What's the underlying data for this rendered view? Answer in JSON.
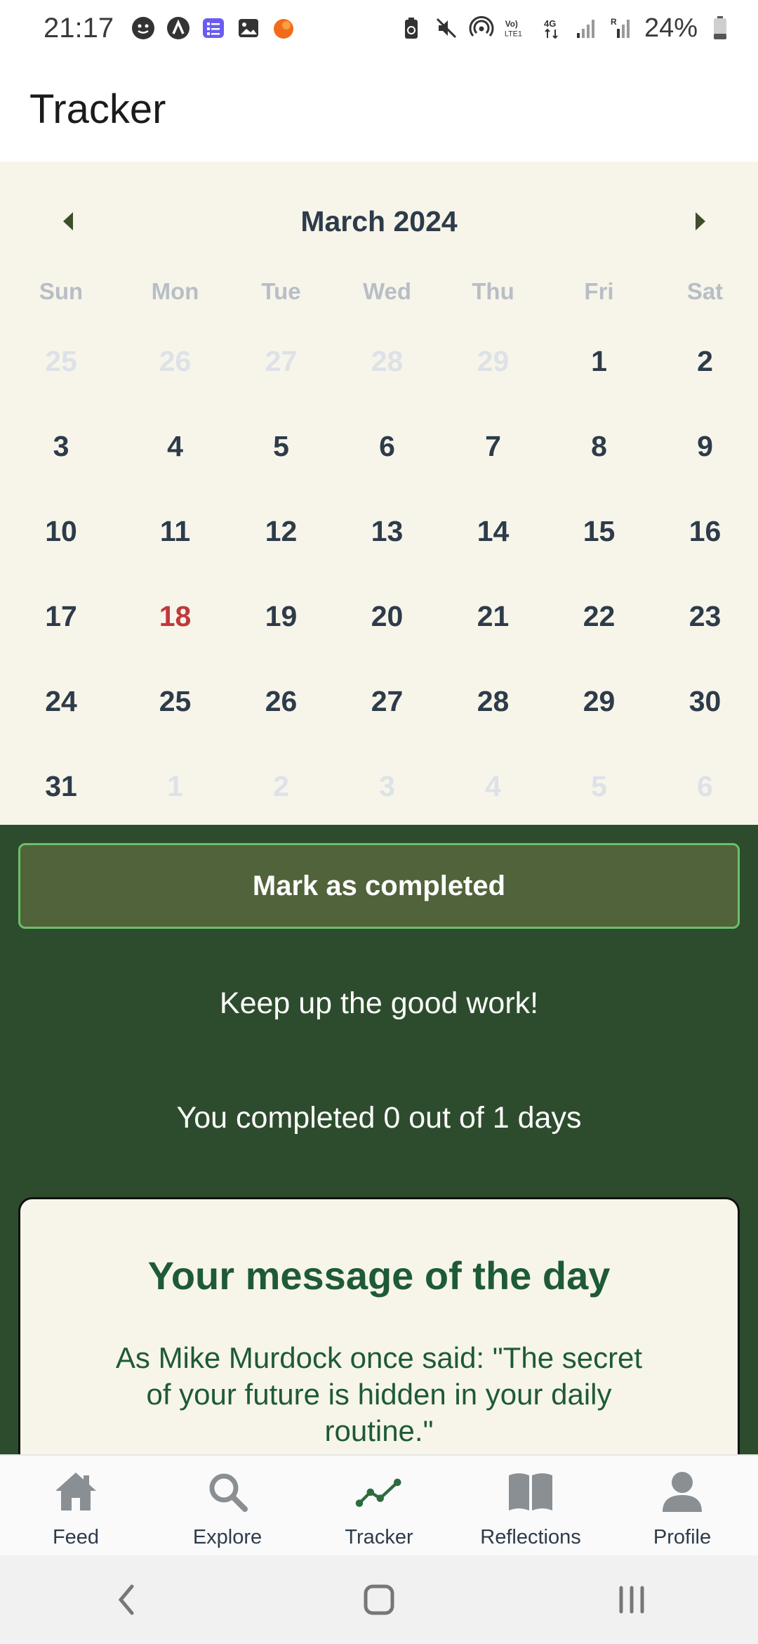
{
  "status_bar": {
    "time": "21:17",
    "battery": "24%",
    "icons": [
      "face-icon",
      "a-logo-icon",
      "list-app-icon",
      "gallery-icon",
      "orange-app-icon",
      "battery-saver-icon",
      "mute-icon",
      "hotspot-icon",
      "volte-icon",
      "4g-icon",
      "signal-icon",
      "signal-roaming-icon",
      "battery-icon"
    ]
  },
  "app_bar": {
    "title": "Tracker"
  },
  "calendar": {
    "month_label": "March 2024",
    "weekdays": [
      "Sun",
      "Mon",
      "Tue",
      "Wed",
      "Thu",
      "Fri",
      "Sat"
    ],
    "weeks": [
      [
        "25",
        "26",
        "27",
        "28",
        "29",
        "1",
        "2"
      ],
      [
        "3",
        "4",
        "5",
        "6",
        "7",
        "8",
        "9"
      ],
      [
        "10",
        "11",
        "12",
        "13",
        "14",
        "15",
        "16"
      ],
      [
        "17",
        "18",
        "19",
        "20",
        "21",
        "22",
        "23"
      ],
      [
        "24",
        "25",
        "26",
        "27",
        "28",
        "29",
        "30"
      ],
      [
        "31",
        "1",
        "2",
        "3",
        "4",
        "5",
        "6"
      ]
    ],
    "today": "18"
  },
  "actions": {
    "mark_completed_label": "Mark as completed",
    "encouragement": "Keep up the good work!",
    "progress_text": "You completed 0 out of 1 days"
  },
  "message_card": {
    "title": "Your message of the day",
    "body": "As Mike Murdock once said: \"The secret of your future is hidden in your daily routine.\""
  },
  "bottom_nav": {
    "items": [
      {
        "label": "Feed",
        "icon": "home-icon"
      },
      {
        "label": "Explore",
        "icon": "search-icon"
      },
      {
        "label": "Tracker",
        "icon": "trend-icon"
      },
      {
        "label": "Reflections",
        "icon": "book-icon"
      },
      {
        "label": "Profile",
        "icon": "person-icon"
      }
    ]
  },
  "colors": {
    "calendar_bg": "#f7f5ea",
    "green_area": "#2d4c2d",
    "button_bg": "#51633a",
    "button_border": "#6bbf6b",
    "today": "#c0393b",
    "message_text": "#1e5a36"
  }
}
